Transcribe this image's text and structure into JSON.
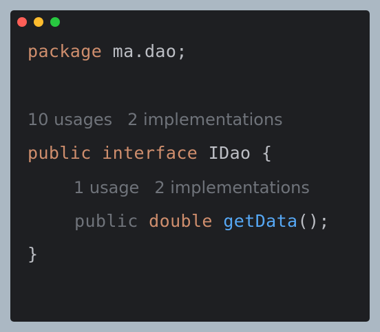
{
  "window": {
    "controls": {
      "close_color": "#ff5f57",
      "minimize_color": "#febc2e",
      "maximize_color": "#28c840"
    }
  },
  "editor": {
    "line_package": {
      "keyword": "package",
      "name": "ma.dao;"
    },
    "hint_interface": {
      "usages": "10 usages",
      "implementations": "2 implementations"
    },
    "line_interface": {
      "modifier": "public",
      "keyword": "interface",
      "name": "IDao",
      "brace": "{"
    },
    "hint_method": {
      "usages": "1 usage",
      "implementations": "2 implementations"
    },
    "line_method": {
      "modifier": "public",
      "return_type": "double",
      "method_name": "getData",
      "params": "();"
    },
    "line_close": {
      "brace": "}"
    }
  },
  "colors": {
    "keyword": "#cf8e6d",
    "text": "#bcbec4",
    "method": "#56a8f5",
    "hint": "#6f737a",
    "editor_background": "#1e1f22",
    "page_background": "#abb8c3"
  }
}
